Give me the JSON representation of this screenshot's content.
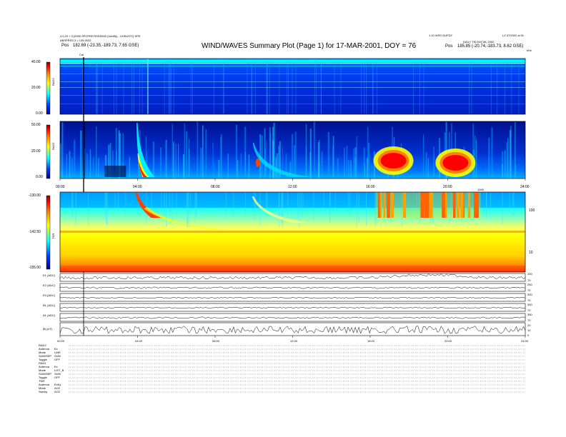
{
  "header": {
    "title": "WIND/WAVES Summary Plot (Page 1) for 17-MAR-2001, DOY = 76",
    "top_left_line1": "4.0.20 + 3 [2000 SPCPRF/SSSS000 (1se0fy) - UHSUSTQ SPE",
    "top_left_line2": "ABSPRSS.3 = 135.0032",
    "pos_left_label": "Pos",
    "pos_left_value": "182.69 (-23.35,-189.73, 7.65 GSE)",
    "top_right_line1": "1.10 WSD DUPZZ",
    "top_right_line2": "DAILY TM 09/2 ML 2002",
    "pos_right_label": "Pos",
    "pos_right_value": "185.85 (-20.74,-183.73, 8.62 GSE)",
    "far_right": "LZ 07/2002 al 01"
  },
  "panels": {
    "rad2": {
      "name": "RAD2",
      "colorbar_ticks": [
        "40.00",
        "20.00",
        "0.00"
      ],
      "units_label": "kHz",
      "bar_label": "Cal"
    },
    "rad1": {
      "name": "RAD1",
      "colorbar_ticks": [
        "50.00",
        "20.00",
        "0.00"
      ],
      "time_ticks": [
        "00:00",
        "04:00",
        "08:00",
        "12:00",
        "16:00",
        "20:00",
        "24:00"
      ]
    },
    "tnr": {
      "name": "TNR",
      "colorbar_ticks": [
        "-130.00",
        "-142.50",
        "-155.00"
      ],
      "right_ticks": [
        "100",
        "10"
      ],
      "right_corner": "1000"
    },
    "lines": [
      {
        "name": "E1 (ADC)",
        "right_ticks": [
          "200",
          "70"
        ]
      },
      {
        "name": "E2 (ADC)",
        "right_ticks": [
          "250",
          "70"
        ]
      },
      {
        "name": "E3 (ADC)",
        "right_ticks": [
          "300",
          "70"
        ]
      },
      {
        "name": "B1 (ADC)",
        "right_ticks": [
          "300",
          "70"
        ]
      },
      {
        "name": "A1 (ADC)",
        "right_ticks": [
          "350",
          "70"
        ]
      },
      {
        "name": "|B| (nT)",
        "right_ticks": [
          "20",
          "10",
          "0"
        ]
      }
    ],
    "bottom_time_ticks": [
      "00:00",
      "04:00",
      "08:00",
      "12:00",
      "16:00",
      "20:00",
      "24:00"
    ]
  },
  "footer": {
    "rows": [
      {
        "k": "RAD2",
        "v": ""
      },
      {
        "k": "Antenna",
        "v": "Ex"
      },
      {
        "k": "Mode",
        "v": "LINE"
      },
      {
        "k": "SUM/SEP",
        "v": "SUM"
      },
      {
        "k": "Toggle",
        "v": "OFF"
      },
      {
        "k": "RAD1",
        "v": ""
      },
      {
        "k": "Antenna",
        "v": "Ex"
      },
      {
        "k": "Mode",
        "v": "LIST_B"
      },
      {
        "k": "SUM/SEP",
        "v": "SUM"
      },
      {
        "k": "Toggle",
        "v": "OFF"
      },
      {
        "k": "TNR",
        "v": ""
      },
      {
        "k": "Antenna",
        "v": "ExEy"
      },
      {
        "k": "Mode",
        "v": "ACE"
      },
      {
        "k": "Sweep",
        "v": "ACE"
      }
    ]
  },
  "colors": {
    "dark_blue": "#00008f",
    "blue": "#0040ff",
    "cyan": "#00ffff",
    "yellow": "#ffff00",
    "orange": "#ff8000",
    "red": "#ff0000",
    "dark_red": "#800000"
  },
  "chart_data": {
    "type": "heatmap",
    "title": "WIND/WAVES Summary Plot (Page 1) for 17-MAR-2001, DOY = 76",
    "x_range_hours": [
      0,
      24
    ],
    "time_ticks": [
      "00:00",
      "04:00",
      "08:00",
      "12:00",
      "16:00",
      "20:00",
      "24:00"
    ],
    "series": [
      {
        "name": "RAD2",
        "colorbar_range": [
          0,
          40
        ]
      },
      {
        "name": "RAD1",
        "colorbar_range": [
          0,
          50
        ]
      },
      {
        "name": "TNR",
        "colorbar_range": [
          -155,
          -130
        ]
      },
      {
        "name": "E1 (ADC)"
      },
      {
        "name": "E2 (ADC)"
      },
      {
        "name": "E3 (ADC)"
      },
      {
        "name": "B1 (ADC)"
      },
      {
        "name": "A1 (ADC)"
      },
      {
        "name": "|B| (nT)"
      }
    ],
    "events": [
      {
        "panel": "RAD1",
        "start_hour": 4.0,
        "type": "type III burst"
      },
      {
        "panel": "RAD1",
        "start_hour": 10.1,
        "type": "burst"
      },
      {
        "panel": "RAD1",
        "start_hour": 16.5,
        "end_hour": 18.2,
        "type": "intense emission"
      },
      {
        "panel": "RAD1",
        "start_hour": 19.4,
        "end_hour": 21.6,
        "type": "intense emission"
      },
      {
        "panel": "TNR",
        "start_hour": 16.3,
        "end_hour": 21.7,
        "type": "intense emission"
      }
    ]
  }
}
